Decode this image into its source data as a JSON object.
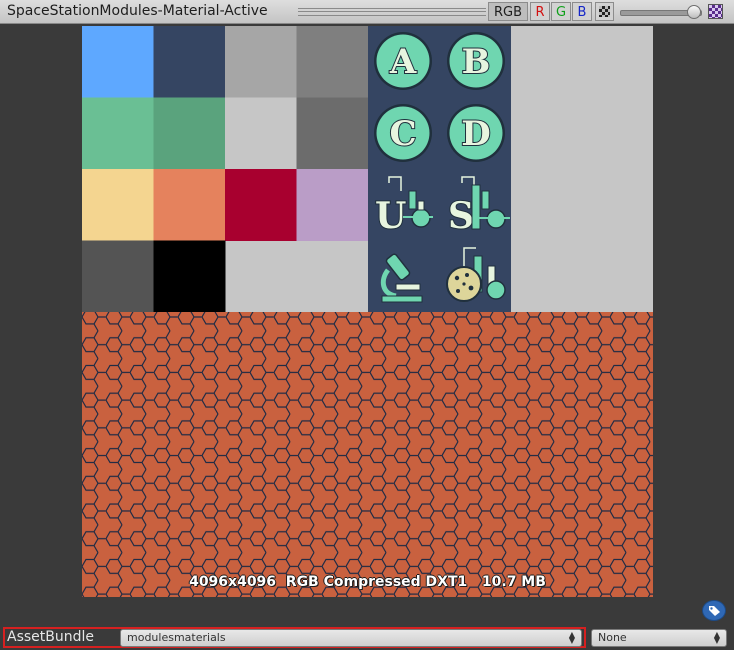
{
  "window": {
    "title": "SpaceStationModules-Material-Active",
    "channel_buttons": {
      "rgb": "RGB",
      "r": "R",
      "g": "G",
      "b": "B"
    },
    "alpha_icon": "checkerboard-icon",
    "mip_icon": "mipmap-checker-icon",
    "mip_level": 1.0
  },
  "texture": {
    "info": "4096x4096  RGB Compressed DXT1   10.7 MB",
    "palette": [
      "#5ea8ff",
      "#354562",
      "#a6a6a6",
      "#7f7f7f",
      "#6abf94",
      "#5aa37d",
      "#c6c6c6",
      "#6c6c6c",
      "#f4d590",
      "#e5825d",
      "#a8002f",
      "#ba9dc7",
      "#545454",
      "#000000"
    ],
    "icon_panel_color": "#354562",
    "icon_accent": "#6fd6b0",
    "background_gray": "#c6c6c6",
    "hex_fill": "#c9613f",
    "hex_line": "#1e2b45",
    "letters": [
      "A",
      "B",
      "C",
      "D"
    ],
    "module_glyphs": [
      "U",
      "S"
    ],
    "icons": [
      "letter-a-badge-icon",
      "letter-b-badge-icon",
      "letter-c-badge-icon",
      "letter-d-badge-icon",
      "module-u-flask-icon",
      "module-s-flask-icon",
      "microscope-icon",
      "planet-flask-icon"
    ]
  },
  "footer": {
    "label": "AssetBundle",
    "bundle_value": "modulesmaterials",
    "variant_value": "None",
    "tag_icon": "tag-icon"
  }
}
